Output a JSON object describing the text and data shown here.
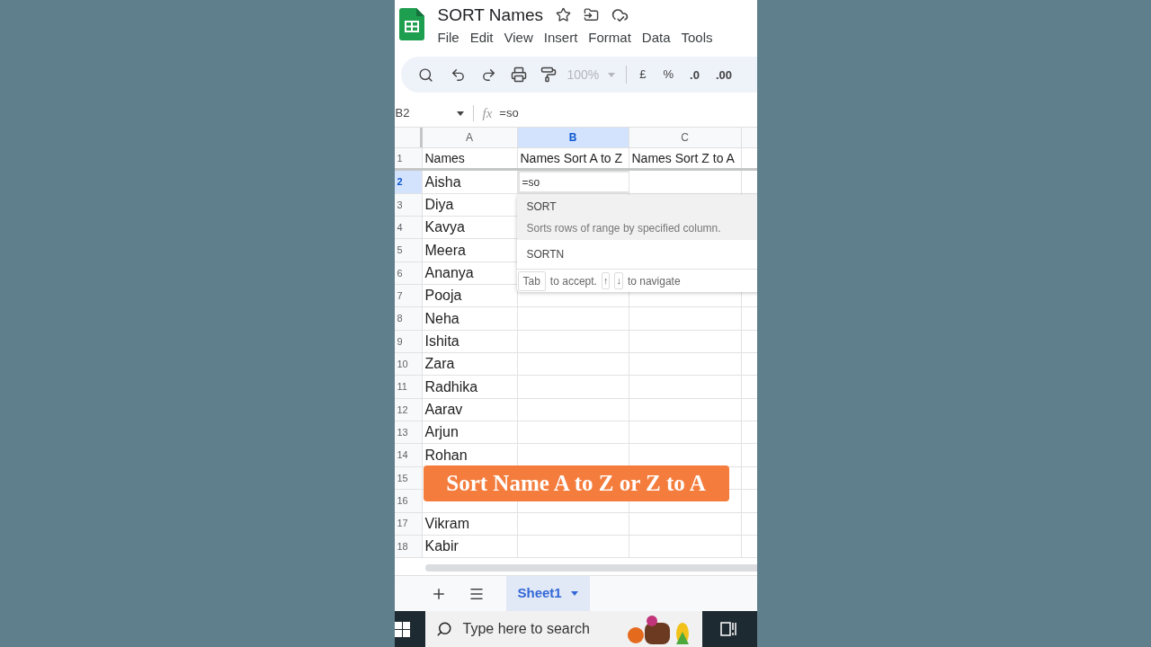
{
  "app": {
    "title": "SORT Names",
    "menu": [
      "File",
      "Edit",
      "View",
      "Insert",
      "Format",
      "Data",
      "Tools"
    ],
    "toolbar": {
      "zoom": "100%",
      "currency": "£",
      "percent": "%",
      "decrease_decimals": ".0",
      "increase_decimals": ".00"
    }
  },
  "formula_bar": {
    "cell": "B2",
    "function_label": "fx",
    "formula": "=so"
  },
  "grid": {
    "columns": [
      {
        "label": "A",
        "selected": false
      },
      {
        "label": "B",
        "selected": true
      },
      {
        "label": "C",
        "selected": false
      }
    ],
    "rows": [
      {
        "number": "1",
        "selected": false,
        "cells": [
          "Names",
          "Names Sort A to Z",
          "Names Sort Z to A"
        ]
      },
      {
        "number": "2",
        "selected": true,
        "cells": [
          "Aisha",
          "=so"
        ]
      },
      {
        "number": "3",
        "selected": false,
        "cells": [
          "Diya"
        ]
      },
      {
        "number": "4",
        "selected": false,
        "cells": [
          "Kavya"
        ]
      },
      {
        "number": "5",
        "selected": false,
        "cells": [
          "Meera"
        ]
      },
      {
        "number": "6",
        "selected": false,
        "cells": [
          "Ananya"
        ]
      },
      {
        "number": "7",
        "selected": false,
        "cells": [
          "Pooja"
        ]
      },
      {
        "number": "8",
        "selected": false,
        "cells": [
          "Neha"
        ]
      },
      {
        "number": "9",
        "selected": false,
        "cells": [
          "Ishita"
        ]
      },
      {
        "number": "10",
        "selected": false,
        "cells": [
          "Zara"
        ]
      },
      {
        "number": "11",
        "selected": false,
        "cells": [
          "Radhika"
        ]
      },
      {
        "number": "12",
        "selected": false,
        "cells": [
          "Aarav"
        ]
      },
      {
        "number": "13",
        "selected": false,
        "cells": [
          "Arjun"
        ]
      },
      {
        "number": "14",
        "selected": false,
        "cells": [
          "Rohan"
        ]
      },
      {
        "number": "15",
        "selected": false
      },
      {
        "number": "16",
        "selected": false
      },
      {
        "number": "17",
        "selected": false,
        "cells": [
          "Vikram"
        ]
      },
      {
        "number": "18",
        "selected": false,
        "cells": [
          "Kabir"
        ]
      }
    ]
  },
  "autocomplete": {
    "items": [
      {
        "name": "SORT",
        "description": "Sorts rows of range by specified column.",
        "selected": true
      },
      {
        "name": "SORTN",
        "selected": false
      }
    ],
    "hint": {
      "key": "Tab",
      "accept": "to accept.",
      "arrows": [
        "↑",
        "↓"
      ],
      "navigate": "to navigate"
    }
  },
  "caption": "Sort Name A to Z or Z to A",
  "sheet_tabs": [
    {
      "label": "Sheet1",
      "selected": true
    }
  ],
  "taskbar": {
    "search_placeholder": "Type here to search"
  }
}
